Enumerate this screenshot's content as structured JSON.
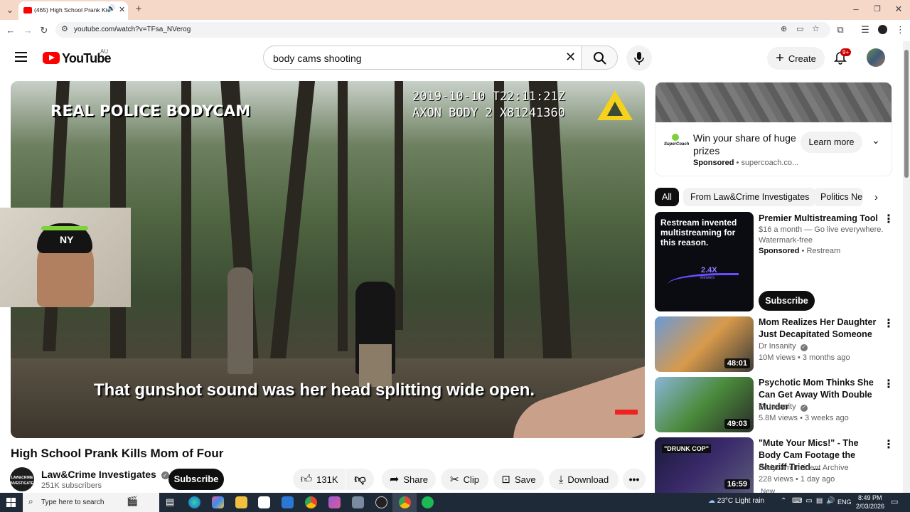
{
  "browser": {
    "tab_title": "(465) High School Prank Kill",
    "url": "youtube.com/watch?v=TFsa_NVerog"
  },
  "header": {
    "logo_text": "YouTube",
    "region": "AU",
    "search_value": "body cams shooting",
    "create_label": "Create",
    "notif_count": "9+"
  },
  "video": {
    "overlay_left": "REAL POLICE BODYCAM",
    "timestamp": "2019-10-10 T22:11:21Z",
    "device": "AXON BODY 2 X81241360",
    "caption": "That gunshot sound was her head splitting wide open.",
    "title": "High School Prank Kills Mom of Four"
  },
  "channel": {
    "name": "Law&Crime Investigates",
    "subscribers": "251K subscribers",
    "avatar_text": "LAW&CRIME INVESTIGATES",
    "subscribe_label": "Subscribe"
  },
  "actions": {
    "likes": "131K",
    "share": "Share",
    "clip": "Clip",
    "save": "Save",
    "download": "Download"
  },
  "ad": {
    "title": "Win your share of huge prizes",
    "sponsored": "Sponsored",
    "domain": "supercoach.co...",
    "cta": "Learn more",
    "brand": "SuperCoach"
  },
  "chips": [
    "All",
    "From Law&Crime Investigates",
    "Politics Ne"
  ],
  "recs": [
    {
      "title": "Premier Multistreaming Tool",
      "line2": "$16 a month — Go live everywhere.",
      "line3": "Watermark-free",
      "sponsored": "Sponsored",
      "advertiser": "Restream",
      "thumb_text": "Restream invented multistreaming for this reason.",
      "thumb_stat": "2.4X",
      "thumb_stat_label": "Viewers",
      "cta": "Subscribe"
    },
    {
      "title": "Mom Realizes Her Daughter Just Decapitated Someone",
      "channel": "Dr Insanity",
      "meta": "10M views • 3 months ago",
      "duration": "48:01"
    },
    {
      "title": "Psychotic Mom Thinks She Can Get Away With Double Murder",
      "channel": "Dr Insanity",
      "meta": "5.8M views • 3 weeks ago",
      "duration": "49:03"
    },
    {
      "title": "\"Mute Your Mics!\" - The Body Cam Footage the Sheriff Tried ...",
      "channel": "Bodycam Incident Archive",
      "meta": "228 views • 1 day ago",
      "badge": "New",
      "duration": "16:59",
      "thumb_text": "\"DRUNK COP\""
    }
  ],
  "taskbar": {
    "search_placeholder": "Type here to search",
    "weather": "23°C  Light rain",
    "lang": "ENG",
    "time": "8:49 PM",
    "date": "2/03/2026"
  },
  "colors": {
    "youtube_red": "#ff0000",
    "subscribe_bg": "#0f0f0f",
    "tabbar": "#f6d8c9",
    "taskbar": "#1f2a38"
  }
}
